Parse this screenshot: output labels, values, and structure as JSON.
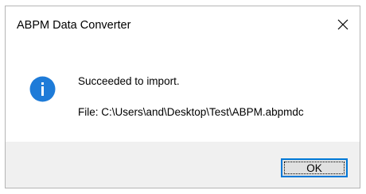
{
  "dialog": {
    "title": "ABPM Data Converter",
    "close_icon": "close-icon",
    "message_icon": "info-icon",
    "message": "Succeeded to import.",
    "detail": "File: C:\\Users\\and\\Desktop\\Test\\ABPM.abpmdc",
    "ok_label": "OK"
  },
  "colors": {
    "info_icon": "#1e7bd8",
    "button_focus_border": "#0078d7",
    "button_background": "#e1e1e1",
    "footer_background": "#f0f0f0"
  }
}
